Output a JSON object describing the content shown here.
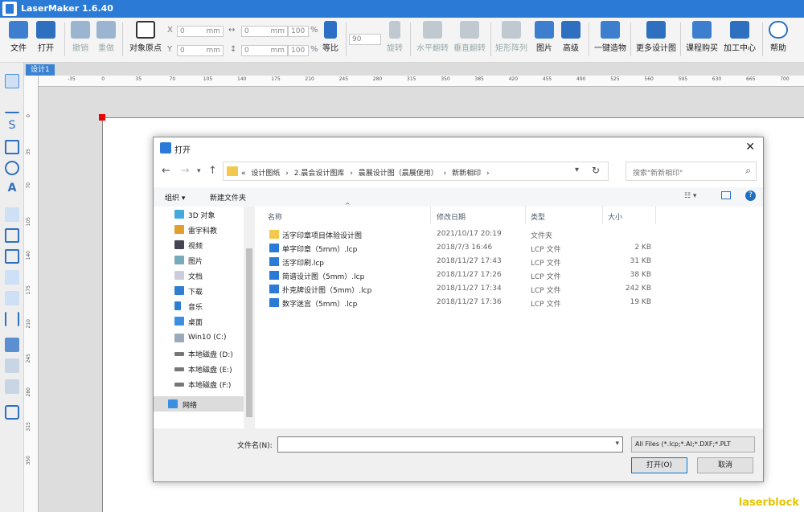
{
  "app": {
    "title": "LaserMaker 1.6.40",
    "brand_color": "#2b7bd6",
    "watermark": "laserblock"
  },
  "toolbar": {
    "file": "文件",
    "open": "打开",
    "undo": "撤销",
    "redo": "重做",
    "origin": "对象原点",
    "x_value": "0",
    "y_value": "0",
    "w_value": "0",
    "h_value": "0",
    "unit": "mm",
    "pct_w": "100",
    "pct_h": "100",
    "pct": "%",
    "ratio": "等比",
    "angle": "90",
    "rotate": "旋转",
    "flip_h": "水平翻转",
    "flip_v": "垂直翻转",
    "array": "矩形阵列",
    "image": "图片",
    "advanced": "高级",
    "one_key": "一键造物",
    "more_designs": "更多设计图",
    "course": "课程购买",
    "process": "加工中心",
    "help": "帮助"
  },
  "tab": {
    "label": "设计1"
  },
  "ruler": {
    "h_ticks": [
      "-35",
      "0",
      "35",
      "70",
      "105",
      "140",
      "175",
      "210",
      "245",
      "280",
      "315",
      "350",
      "385",
      "420",
      "455",
      "490",
      "525",
      "560",
      "595",
      "630",
      "665",
      "700"
    ],
    "v_ticks": [
      "0",
      "35",
      "70",
      "105",
      "140",
      "175",
      "210",
      "245",
      "280",
      "315",
      "350"
    ]
  },
  "dialog": {
    "title": "打开",
    "breadcrumbs": [
      "«",
      "设计图纸",
      "›",
      "2.晨会设计图库",
      "›",
      "晨展设计图（晨展使用）",
      "›",
      "新新相印",
      "›"
    ],
    "search_placeholder": "搜索\"新新相印\"",
    "organize": "组织 ▾",
    "new_folder": "新建文件夹",
    "nav_items": [
      "3D 对象",
      "雷宇科教",
      "视频",
      "图片",
      "文档",
      "下载",
      "音乐",
      "桌面",
      "Win10 (C:)",
      "本地磁盘 (D:)",
      "本地磁盘 (E:)",
      "本地磁盘 (F:)",
      "网络"
    ],
    "columns": {
      "name": "名称",
      "date": "修改日期",
      "type": "类型",
      "size": "大小"
    },
    "files": [
      {
        "name": "活字印章项目体验设计图",
        "date": "2021/10/17 20:19",
        "type": "文件夹",
        "size": ""
      },
      {
        "name": "单字印章（5mm）.lcp",
        "date": "2018/7/3 16:46",
        "type": "LCP 文件",
        "size": "2 KB"
      },
      {
        "name": "活字印刷.lcp",
        "date": "2018/11/27 17:43",
        "type": "LCP 文件",
        "size": "31 KB"
      },
      {
        "name": "简谱设计图（5mm）.lcp",
        "date": "2018/11/27 17:26",
        "type": "LCP 文件",
        "size": "38 KB"
      },
      {
        "name": "扑克牌设计图（5mm）.lcp",
        "date": "2018/11/27 17:34",
        "type": "LCP 文件",
        "size": "242 KB"
      },
      {
        "name": "数字迷宫（5mm）.lcp",
        "date": "2018/11/27 17:36",
        "type": "LCP 文件",
        "size": "19 KB"
      }
    ],
    "filename_label": "文件名(N):",
    "filename_value": "",
    "filter": "All Files  (*.lcp;*.AI;*.DXF;*.PLT",
    "open_button": "打开(O)",
    "cancel_button": "取消"
  }
}
